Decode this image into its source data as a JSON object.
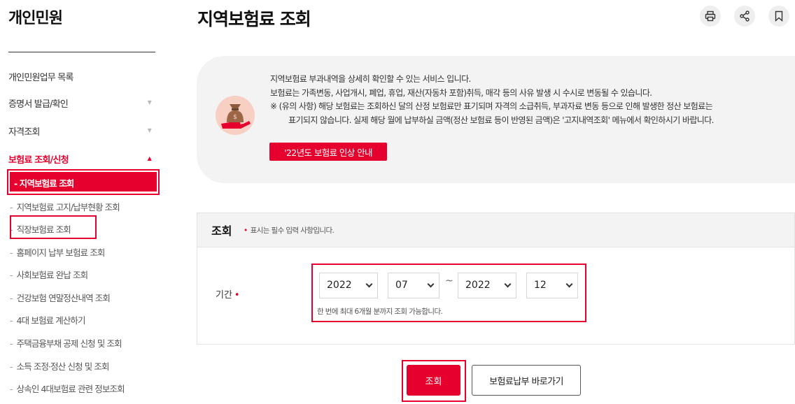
{
  "sidebar": {
    "title": "개인민원",
    "items": [
      {
        "label": "개인민원업무 목록",
        "chevron": ""
      },
      {
        "label": "증명서 발급/확인",
        "chevron": "▼"
      },
      {
        "label": "자격조회",
        "chevron": "▼"
      },
      {
        "label": "보험료 조회/신청",
        "chevron": "▲"
      }
    ],
    "active_sub": "- 지역보험료 조회",
    "sub_items": [
      "지역보험료 고지/납부현황 조회",
      "직장보험료 조회",
      "홈페이지 납부 보험료 조회",
      "사회보험료 완납 조회",
      "건강보험 연말정산내역 조회",
      "4대 보험료 계산하기",
      "주택금융부채 공제 신청 및 조회",
      "소득 조정·정산 신청 및 조회",
      "상속인 4대보험료 관련 정보조회"
    ],
    "dash": "-"
  },
  "header": {
    "title": "지역보험료 조회",
    "icons": [
      "print-icon",
      "share-icon",
      "bookmark-icon"
    ]
  },
  "info": {
    "line1": "지역보험료 부과내역을 상세히 확인할 수 있는 서비스 입니다.",
    "line2": "보험료는 가족변동, 사업개시, 폐업, 휴업, 재산(자동차 포함)취득, 매각 등의 사유 발생 시 수시로 변동될 수 있습니다.",
    "line3": "※ (유의 사항) 해당 보험료는 조회하신 달의 산정 보험료만 표기되며 자격의 소급취득, 부과자료 변동 등으로 인해 발생한 정산 보험료는",
    "line4": "표기되지 않습니다. 실제 해당 월에 납부하실 금액(정산 보험료 등이 반영된 금액)은 '고지내역조회' 메뉴에서 확인하시기 바랍니다.",
    "notice_button": "'22년도 보험료 인상 안내"
  },
  "form": {
    "title": "조회",
    "required_note": "표시는 필수 입력 사항입니다.",
    "period_label": "기간",
    "start_year": "2022",
    "start_month": "07",
    "separator": "~",
    "end_year": "2022",
    "end_month": "12",
    "hint": "한 번에 최대 6개월 분까지 조회 가능합니다."
  },
  "buttons": {
    "search": "조회",
    "payment_link": "보험료납부 바로가기"
  },
  "colors": {
    "accent": "#e6002d",
    "panel": "#f3f3f3"
  }
}
